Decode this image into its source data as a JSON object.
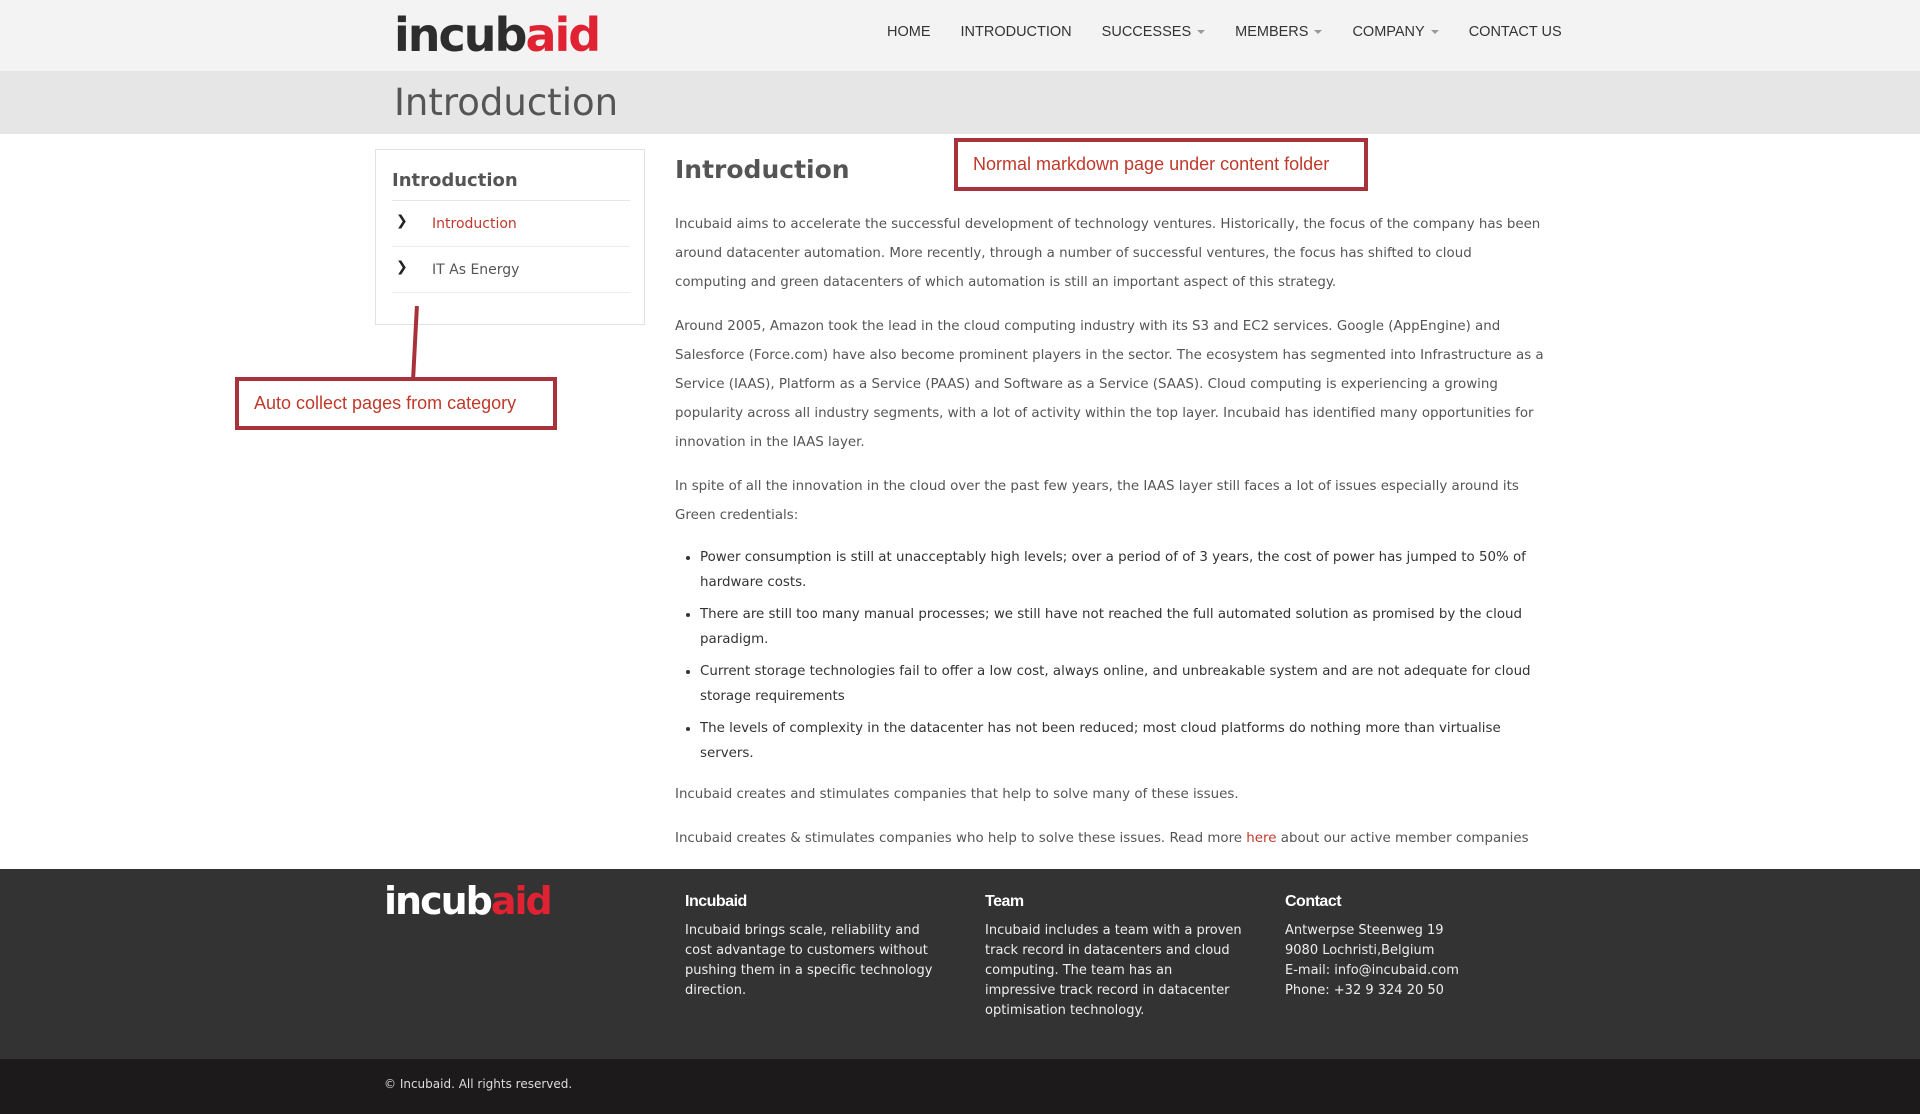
{
  "header": {
    "logo_dark": "incub",
    "logo_red": "aid",
    "nav": [
      {
        "label": "HOME",
        "dropdown": false
      },
      {
        "label": "INTRODUCTION",
        "dropdown": false
      },
      {
        "label": "SUCCESSES",
        "dropdown": true
      },
      {
        "label": "MEMBERS",
        "dropdown": true
      },
      {
        "label": "COMPANY",
        "dropdown": true
      },
      {
        "label": "CONTACT US",
        "dropdown": false
      }
    ]
  },
  "page_title": "Introduction",
  "sidebar": {
    "title": "Introduction",
    "items": [
      {
        "label": "Introduction",
        "active": true,
        "icon": "chevron-right-icon"
      },
      {
        "label": "IT As Energy",
        "active": false,
        "icon": "chevron-right-icon"
      }
    ]
  },
  "main": {
    "heading": "Introduction",
    "paragraphs": [
      "Incubaid aims to accelerate the successful development of technology ventures. Historically, the focus of the company has been around datacenter automation. More recently, through a number of successful ventures, the focus has shifted to cloud computing and green datacenters of which automation is still an important aspect of this strategy.",
      "Around 2005, Amazon took the lead in the cloud computing industry with its S3 and EC2 services. Google (AppEngine) and Salesforce (Force.com) have also become prominent players in the sector. The ecosystem has segmented into Infrastructure as a Service (IAAS), Platform as a Service (PAAS) and Software as a Service (SAAS). Cloud computing is experiencing a growing popularity across all industry segments, with a lot of activity within the top layer. Incubaid has identified many opportunities for innovation in the IAAS layer.",
      "In spite of all the innovation in the cloud over the past few years, the IAAS layer still faces a lot of issues especially around its Green credentials:"
    ],
    "bullets": [
      "Power consumption is still at unacceptably high levels; over a period of of 3 years, the cost of power has jumped to 50% of hardware costs.",
      "There are still too many manual processes; we still have not reached the full automated solution as promised by the cloud paradigm.",
      "Current storage technologies fail to offer a low cost, always online, and unbreakable system and are not adequate for cloud storage requirements",
      "The levels of complexity in the datacenter has not been reduced; most cloud platforms do nothing more than virtualise servers."
    ],
    "after_list": "Incubaid creates and stimulates companies that help to solve many of these issues.",
    "last_before": "Incubaid creates & stimulates companies who help to solve these issues. Read more ",
    "last_link": "here",
    "last_after": " about our active member companies"
  },
  "annotations": {
    "content_note": "Normal markdown page under content folder",
    "category_note": "Auto collect pages from category"
  },
  "footer": {
    "logo_light": "incub",
    "logo_red": "aid",
    "col1": {
      "title": "Incubaid",
      "text": "Incubaid brings scale, reliability and cost advantage to customers without pushing them in a specific technology direction."
    },
    "col2": {
      "title": "Team",
      "text": "Incubaid includes a team with a proven track record in datacenters and cloud computing. The team has an impressive track record in datacenter optimisation technology."
    },
    "col3": {
      "title": "Contact",
      "lines": [
        "Antwerpse Steenweg 19",
        "9080 Lochristi,Belgium",
        "E-mail: info@incubaid.com",
        "Phone: +32 9 324 20 50"
      ]
    },
    "copyright": "© Incubaid. All rights reserved."
  },
  "colors": {
    "accent": "#c0392b",
    "brand_red": "#e02232",
    "annotation_border": "#a8323a",
    "footer_bg": "#333333",
    "copyright_bg": "#1d1a1b"
  }
}
